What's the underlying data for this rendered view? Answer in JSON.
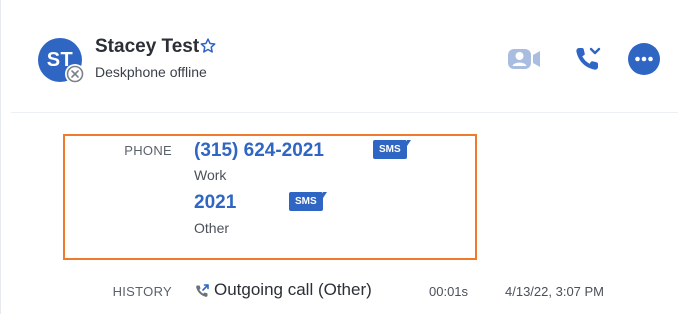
{
  "contact": {
    "initials": "ST",
    "name": "Stacey Test",
    "status": "Deskphone offline",
    "star_icon": "star-outline-icon",
    "presence_icon": "offline-x-icon"
  },
  "actions": {
    "video_icon": "video-call-icon",
    "call_icon": "phone-call-dropdown-icon",
    "more_icon": "more-options-icon"
  },
  "phone_section": {
    "label": "PHONE",
    "numbers": [
      {
        "number": "(315) 624-2021",
        "type": "Work",
        "sms_label": "SMS"
      },
      {
        "number": "2021",
        "type": "Other",
        "sms_label": "SMS"
      }
    ]
  },
  "history": {
    "label": "HISTORY",
    "icon": "outgoing-call-icon",
    "entry": "Outgoing call (Other)",
    "duration": "00:01s",
    "time": "4/13/22, 3:07 PM"
  },
  "colors": {
    "accent": "#2f66c4",
    "highlight": "#f07a2b",
    "video_icon": "#a9bde0"
  }
}
